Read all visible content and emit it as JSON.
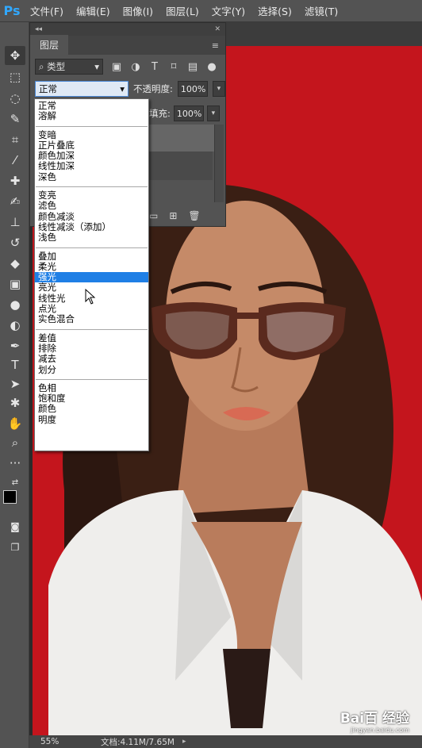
{
  "app": {
    "logo": "Ps"
  },
  "menubar": {
    "items": [
      "文件(F)",
      "编辑(E)",
      "图像(I)",
      "图层(L)",
      "文字(Y)",
      "选择(S)",
      "滤镜(T)"
    ]
  },
  "toolbar": {
    "tools": [
      "move-icon",
      "marquee-icon",
      "lasso-icon",
      "quick-select-icon",
      "crop-icon",
      "eyedropper-icon",
      "healing-icon",
      "brush-icon",
      "stamp-icon",
      "history-brush-icon",
      "eraser-icon",
      "gradient-icon",
      "blur-icon",
      "dodge-icon",
      "pen-icon",
      "type-icon",
      "path-select-icon",
      "shape-icon",
      "hand-icon",
      "zoom-icon",
      "more-icon",
      "swap-colors-icon",
      "foreground-color",
      "quick-mask-icon",
      "screen-mode-icon"
    ]
  },
  "panel": {
    "title": "图层",
    "filter_label": "类型",
    "blend_mode": "正常",
    "opacity_label": "不透明度:",
    "opacity_value": "100%",
    "fill_label": "填充:",
    "fill_value": "100%"
  },
  "dropdown": {
    "groups": [
      [
        "正常",
        "溶解"
      ],
      [
        "变暗",
        "正片叠底",
        "颜色加深",
        "线性加深",
        "深色"
      ],
      [
        "变亮",
        "滤色",
        "颜色减淡",
        "线性减淡（添加）",
        "浅色"
      ],
      [
        "叠加",
        "柔光",
        "强光",
        "亮光",
        "线性光",
        "点光",
        "实色混合"
      ],
      [
        "差值",
        "排除",
        "减去",
        "划分"
      ],
      [
        "色相",
        "饱和度",
        "颜色",
        "明度"
      ]
    ],
    "highlighted": "强光"
  },
  "status": {
    "zoom": "55%",
    "doc": "文档:4.11M/7.65M"
  },
  "watermark": {
    "brand": "Bai百 经验",
    "url": "jingyan.baidu.com"
  },
  "colors": {
    "background_red": "#c4151d",
    "highlight_blue": "#1f7fe5",
    "ps_blue": "#31a8ff"
  }
}
